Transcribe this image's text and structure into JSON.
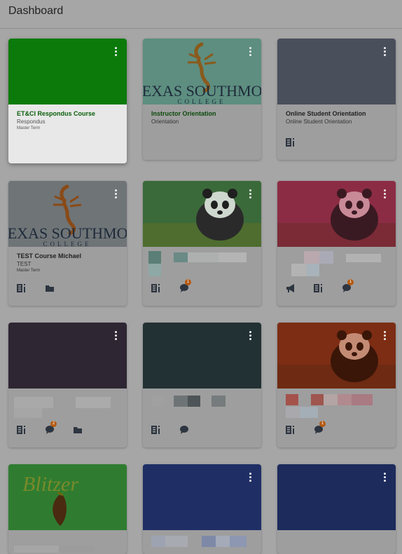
{
  "header": {
    "title": "Dashboard"
  },
  "cards": [
    {
      "title": "ET&CI Respondus Course",
      "subtitle": "Respondus",
      "term": "Master Term",
      "color": "#0b7a0b"
    },
    {
      "title": "Instructor Orientation",
      "subtitle": "Orientation",
      "color": "#5d9a8a"
    },
    {
      "title": "Online Student Orientation",
      "subtitle": "Online Student Orientation",
      "color": "#4a4f5c"
    },
    {
      "title": "TEST Course Michael",
      "subtitle": "TEST",
      "term": "Master Term",
      "color": "#6f7477"
    },
    {
      "color": "#3f6b3f",
      "badge": "1"
    },
    {
      "color": "#8f2b44",
      "badge": "1"
    },
    {
      "color": "#2e2632",
      "badge": "2"
    },
    {
      "color": "#223134"
    },
    {
      "color": "#7a2a12",
      "badge": "1"
    },
    {
      "color": "#2c7b2c"
    },
    {
      "color": "#1f2f66"
    },
    {
      "color": "#1c2b5c"
    }
  ],
  "logo": {
    "line1": "TEXAS SOUTHMOS",
    "line2": "COLLEGE"
  },
  "blitzer": {
    "text": "Blitzer"
  },
  "icons": [
    "syllabus-icon",
    "folder-icon",
    "discussion-icon",
    "announcement-icon"
  ]
}
